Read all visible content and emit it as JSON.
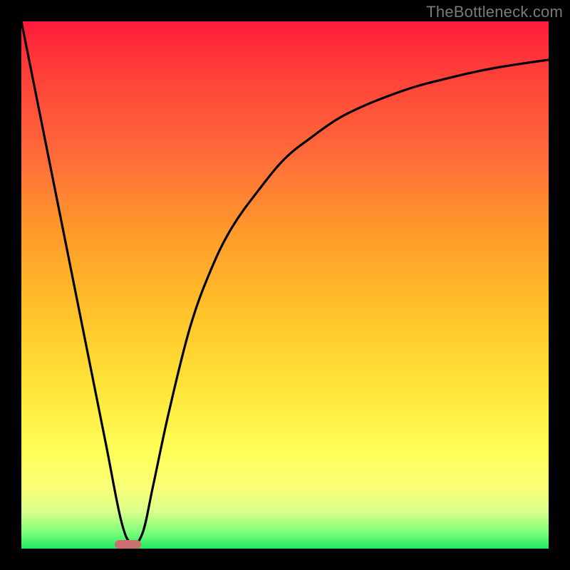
{
  "watermark": "TheBottleneck.com",
  "chart_data": {
    "type": "line",
    "title": "",
    "xlabel": "",
    "ylabel": "",
    "xlim": [
      0,
      100
    ],
    "ylim": [
      0,
      100
    ],
    "grid": false,
    "series": [
      {
        "name": "bottleneck-curve",
        "x": [
          0,
          4,
          8,
          12,
          16,
          19,
          21,
          23,
          25,
          28,
          32,
          36,
          40,
          45,
          50,
          55,
          60,
          65,
          70,
          75,
          80,
          85,
          90,
          95,
          100
        ],
        "values": [
          100,
          80,
          60,
          40,
          20,
          5,
          1,
          3,
          12,
          26,
          42,
          53,
          61,
          68,
          74,
          78,
          81.5,
          84,
          86,
          87.7,
          89,
          90.2,
          91.2,
          92,
          92.7
        ]
      }
    ],
    "marker": {
      "name": "optimal-range",
      "x_center_pct": 20.2,
      "width_pct": 5.0,
      "color": "#cc6f6f"
    },
    "background_gradient": {
      "top": "#ff1a3a",
      "middle": "#ffe63a",
      "bottom": "#20e860"
    }
  }
}
